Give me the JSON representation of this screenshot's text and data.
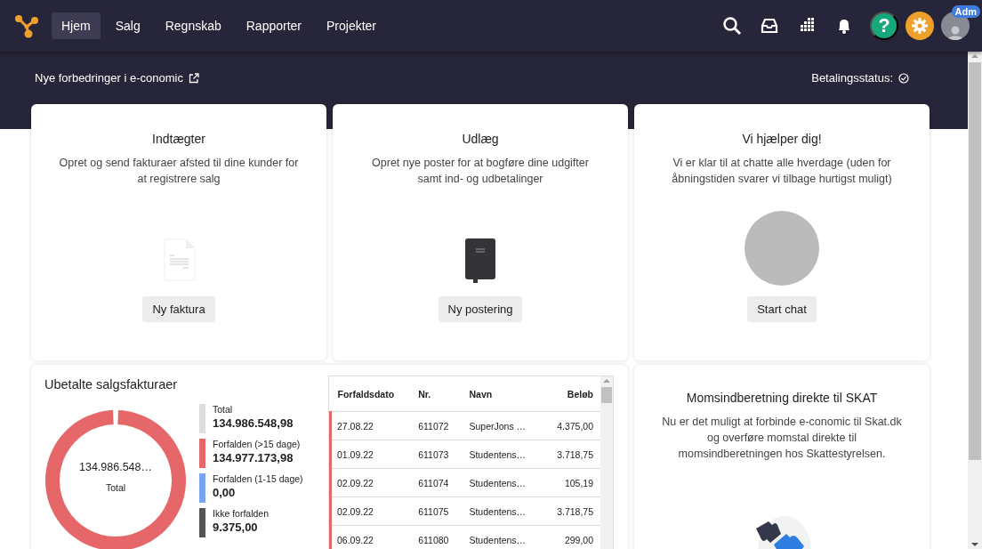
{
  "nav": {
    "items": [
      {
        "label": "Hjem",
        "selected": true
      },
      {
        "label": "Salg",
        "selected": false
      },
      {
        "label": "Regnskab",
        "selected": false
      },
      {
        "label": "Rapporter",
        "selected": false
      },
      {
        "label": "Projekter",
        "selected": false
      }
    ],
    "help": "?",
    "avatar_badge": "Adm"
  },
  "subheader": {
    "link": "Nye forbedringer i e-conomic",
    "status": "Betalingsstatus:"
  },
  "cards": [
    {
      "kind": "document",
      "title": "Indtægter",
      "text": "Opret og send fakturaer afsted til dine kunder for at registrere salg",
      "button": "Ny faktura"
    },
    {
      "kind": "book",
      "title": "Udlæg",
      "text": "Opret nye poster for at bogføre dine udgifter samt ind- og udbetalinger",
      "button": "Ny postering"
    },
    {
      "kind": "photo",
      "title": "Vi hjælper dig!",
      "text": "Vi er klar til at chatte alle hverdage (uden for åbningstiden svarer vi tilbage hurtigst muligt)",
      "button": "Start chat"
    }
  ],
  "invoices": {
    "title": "Ubetalte salgsfakturaer",
    "center_value": "134.986.548…",
    "center_label": "Total",
    "legend": [
      {
        "label": "Total",
        "value": "134.986.548,98",
        "color": "#dddddd"
      },
      {
        "label": "Forfalden (>15 dage)",
        "value": "134.977.173,98",
        "color": "#e5676a"
      },
      {
        "label": "Forfalden (1-15 dage)",
        "value": "0,00",
        "color": "#7ba4f0"
      },
      {
        "label": "Ikke forfalden",
        "value": "9.375,00",
        "color": "#555555"
      }
    ],
    "table": {
      "columns": [
        "Forfaldsdato",
        "Nr.",
        "Navn",
        "Beløb"
      ],
      "rows": [
        {
          "overdue": true,
          "cells": [
            "27.08.22",
            "611072",
            "SuperJons …",
            "4.375,00"
          ]
        },
        {
          "overdue": true,
          "cells": [
            "01.09.22",
            "611073",
            "Studentens…",
            "3.718,75"
          ]
        },
        {
          "overdue": true,
          "cells": [
            "02.09.22",
            "611074",
            "Studentens…",
            "105,19"
          ]
        },
        {
          "overdue": true,
          "cells": [
            "02.09.22",
            "611075",
            "Studentens…",
            "3.718,75"
          ]
        },
        {
          "overdue": true,
          "cells": [
            "06.09.22",
            "611080",
            "Studentens…",
            "299,00"
          ]
        }
      ]
    }
  },
  "vat": {
    "title": "Momsindberetning direkte til SKAT",
    "text": "Nu er det muligt at forbinde e-conomic til Skat.dk og overføre momstal direkte til momsindberetningen hos Skattestyrelsen."
  }
}
